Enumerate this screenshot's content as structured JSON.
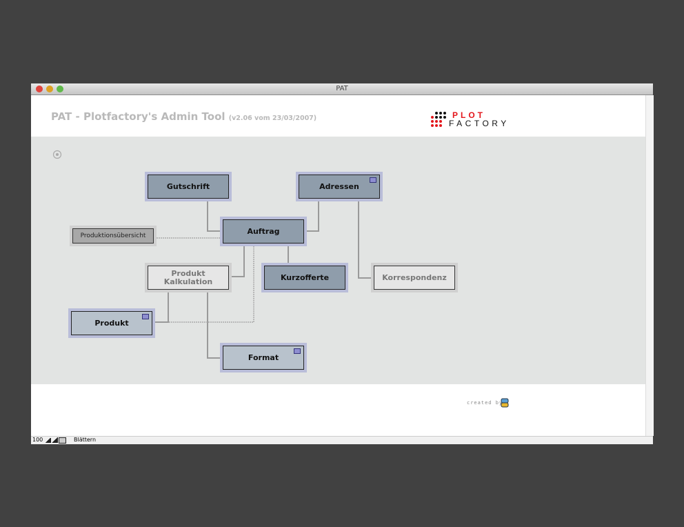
{
  "window": {
    "title": "PAT"
  },
  "header": {
    "title": "PAT - Plotfactory's Admin Tool",
    "version": "(v2.06 vom 23/03/2007)",
    "logo": {
      "line1": "PLOT",
      "line2": "FACTORY",
      "colors": {
        "red": "#e3161b",
        "black": "#111111"
      }
    }
  },
  "nodes": {
    "gutschrift": "Gutschrift",
    "adressen": "Adressen",
    "auftrag": "Auftrag",
    "produktionsuebersicht": "Produktionsübersicht",
    "produkt_kalkulation": "Produkt Kalkulation",
    "kurzofferte": "Kurzofferte",
    "korrespondenz": "Korrespondenz",
    "produkt": "Produkt",
    "format": "Format"
  },
  "footer": {
    "created_by": "created by"
  },
  "statusbar": {
    "zoom": "100",
    "mode": "Blättern"
  },
  "colors": {
    "node_dark": "#8f9dab",
    "node_light": "#b8c2cc",
    "node_frame": "#b9bdd9",
    "node_inactive": "#e6e6e6",
    "canvas": "#e2e4e3"
  }
}
